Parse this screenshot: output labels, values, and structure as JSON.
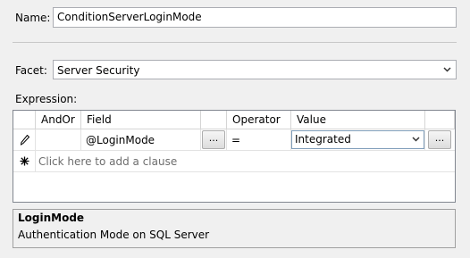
{
  "name": {
    "label": "Name:",
    "value": "ConditionServerLoginMode"
  },
  "facet": {
    "label": "Facet:",
    "selected": "Server Security"
  },
  "expression": {
    "label": "Expression:",
    "columns": [
      "AndOr",
      "Field",
      "Operator",
      "Value"
    ],
    "rows": [
      {
        "andor": "",
        "field": "@LoginMode",
        "field_button": "...",
        "operator": "=",
        "value": "Integrated",
        "value_button": "..."
      }
    ],
    "add_clause_placeholder": "Click here to add a clause"
  },
  "description": {
    "title": "LoginMode",
    "text": "Authentication Mode on SQL Server"
  },
  "icons": {
    "edit_row": "pencil-icon",
    "new_row": "asterisk-icon",
    "dropdown": "chevron-down-icon"
  }
}
